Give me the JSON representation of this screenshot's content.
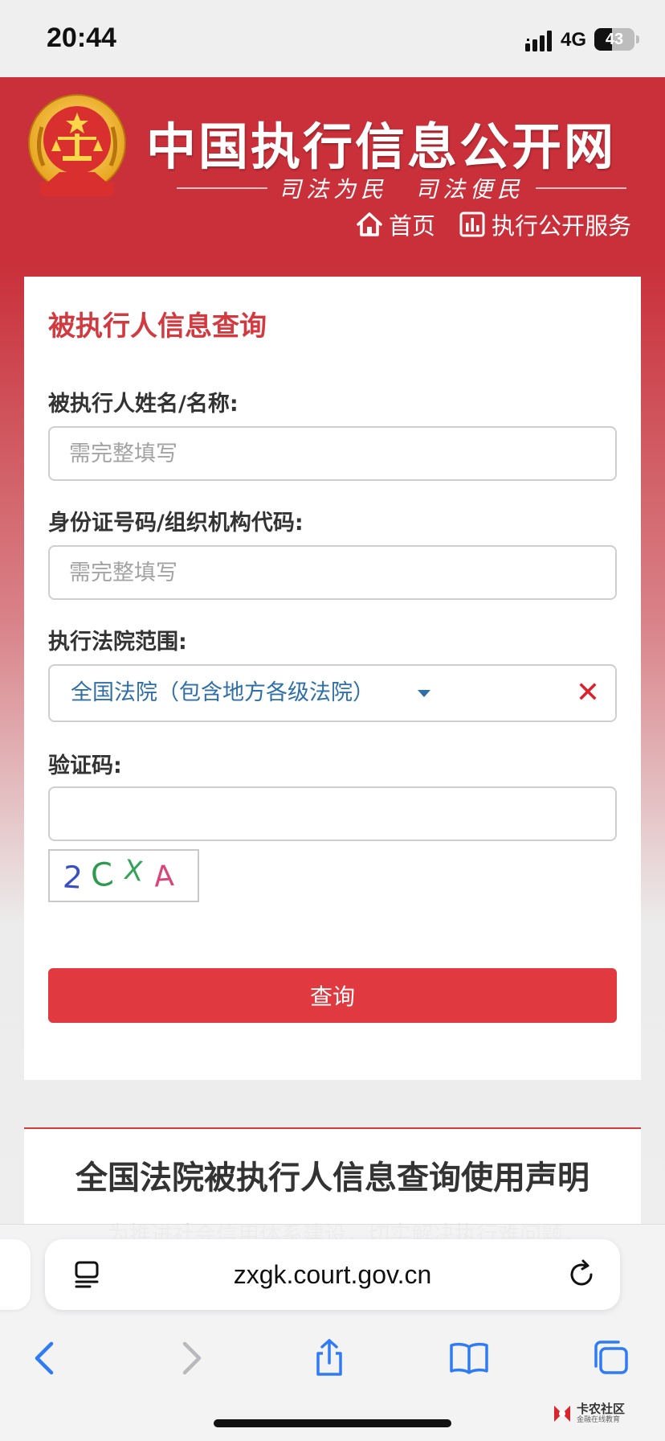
{
  "status_bar": {
    "time": "20:44",
    "network": "4G",
    "battery": "43",
    "battery_level": 0.43
  },
  "header": {
    "emblem_icon": "national-emblem-icon",
    "site_title": "中国执行信息公开网",
    "slogan": "司法为民　司法便民",
    "nav": [
      {
        "icon": "home-icon",
        "label": "首页"
      },
      {
        "icon": "chart-icon",
        "label": "执行公开服务"
      }
    ]
  },
  "form": {
    "title": "被执行人信息查询",
    "name_label": "被执行人姓名/名称:",
    "name_placeholder": "需完整填写",
    "id_label": "身份证号码/组织机构代码:",
    "id_placeholder": "需完整填写",
    "court_label": "执行法院范围:",
    "court_value": "全国法院（包含地方各级法院）",
    "captcha_label": "验证码:",
    "captcha_value": "2CXA",
    "submit_label": "查询"
  },
  "declaration": {
    "title": "全国法院被执行人信息查询使用声明",
    "body": "为推进社会信用体系建设，切实解决执行难问题，"
  },
  "browser": {
    "url": "zxgk.court.gov.cn",
    "toolbar": [
      "back-icon",
      "forward-icon",
      "share-icon",
      "bookmarks-icon",
      "tabs-icon"
    ]
  },
  "watermark": {
    "main": "卡农社区",
    "sub": "金融在线教育"
  },
  "colors": {
    "brand_red": "#c9303a",
    "title_red": "#d33a40",
    "button_red": "#e0393f",
    "link_blue": "#2f6fa8",
    "ios_blue": "#2f7bf6"
  }
}
